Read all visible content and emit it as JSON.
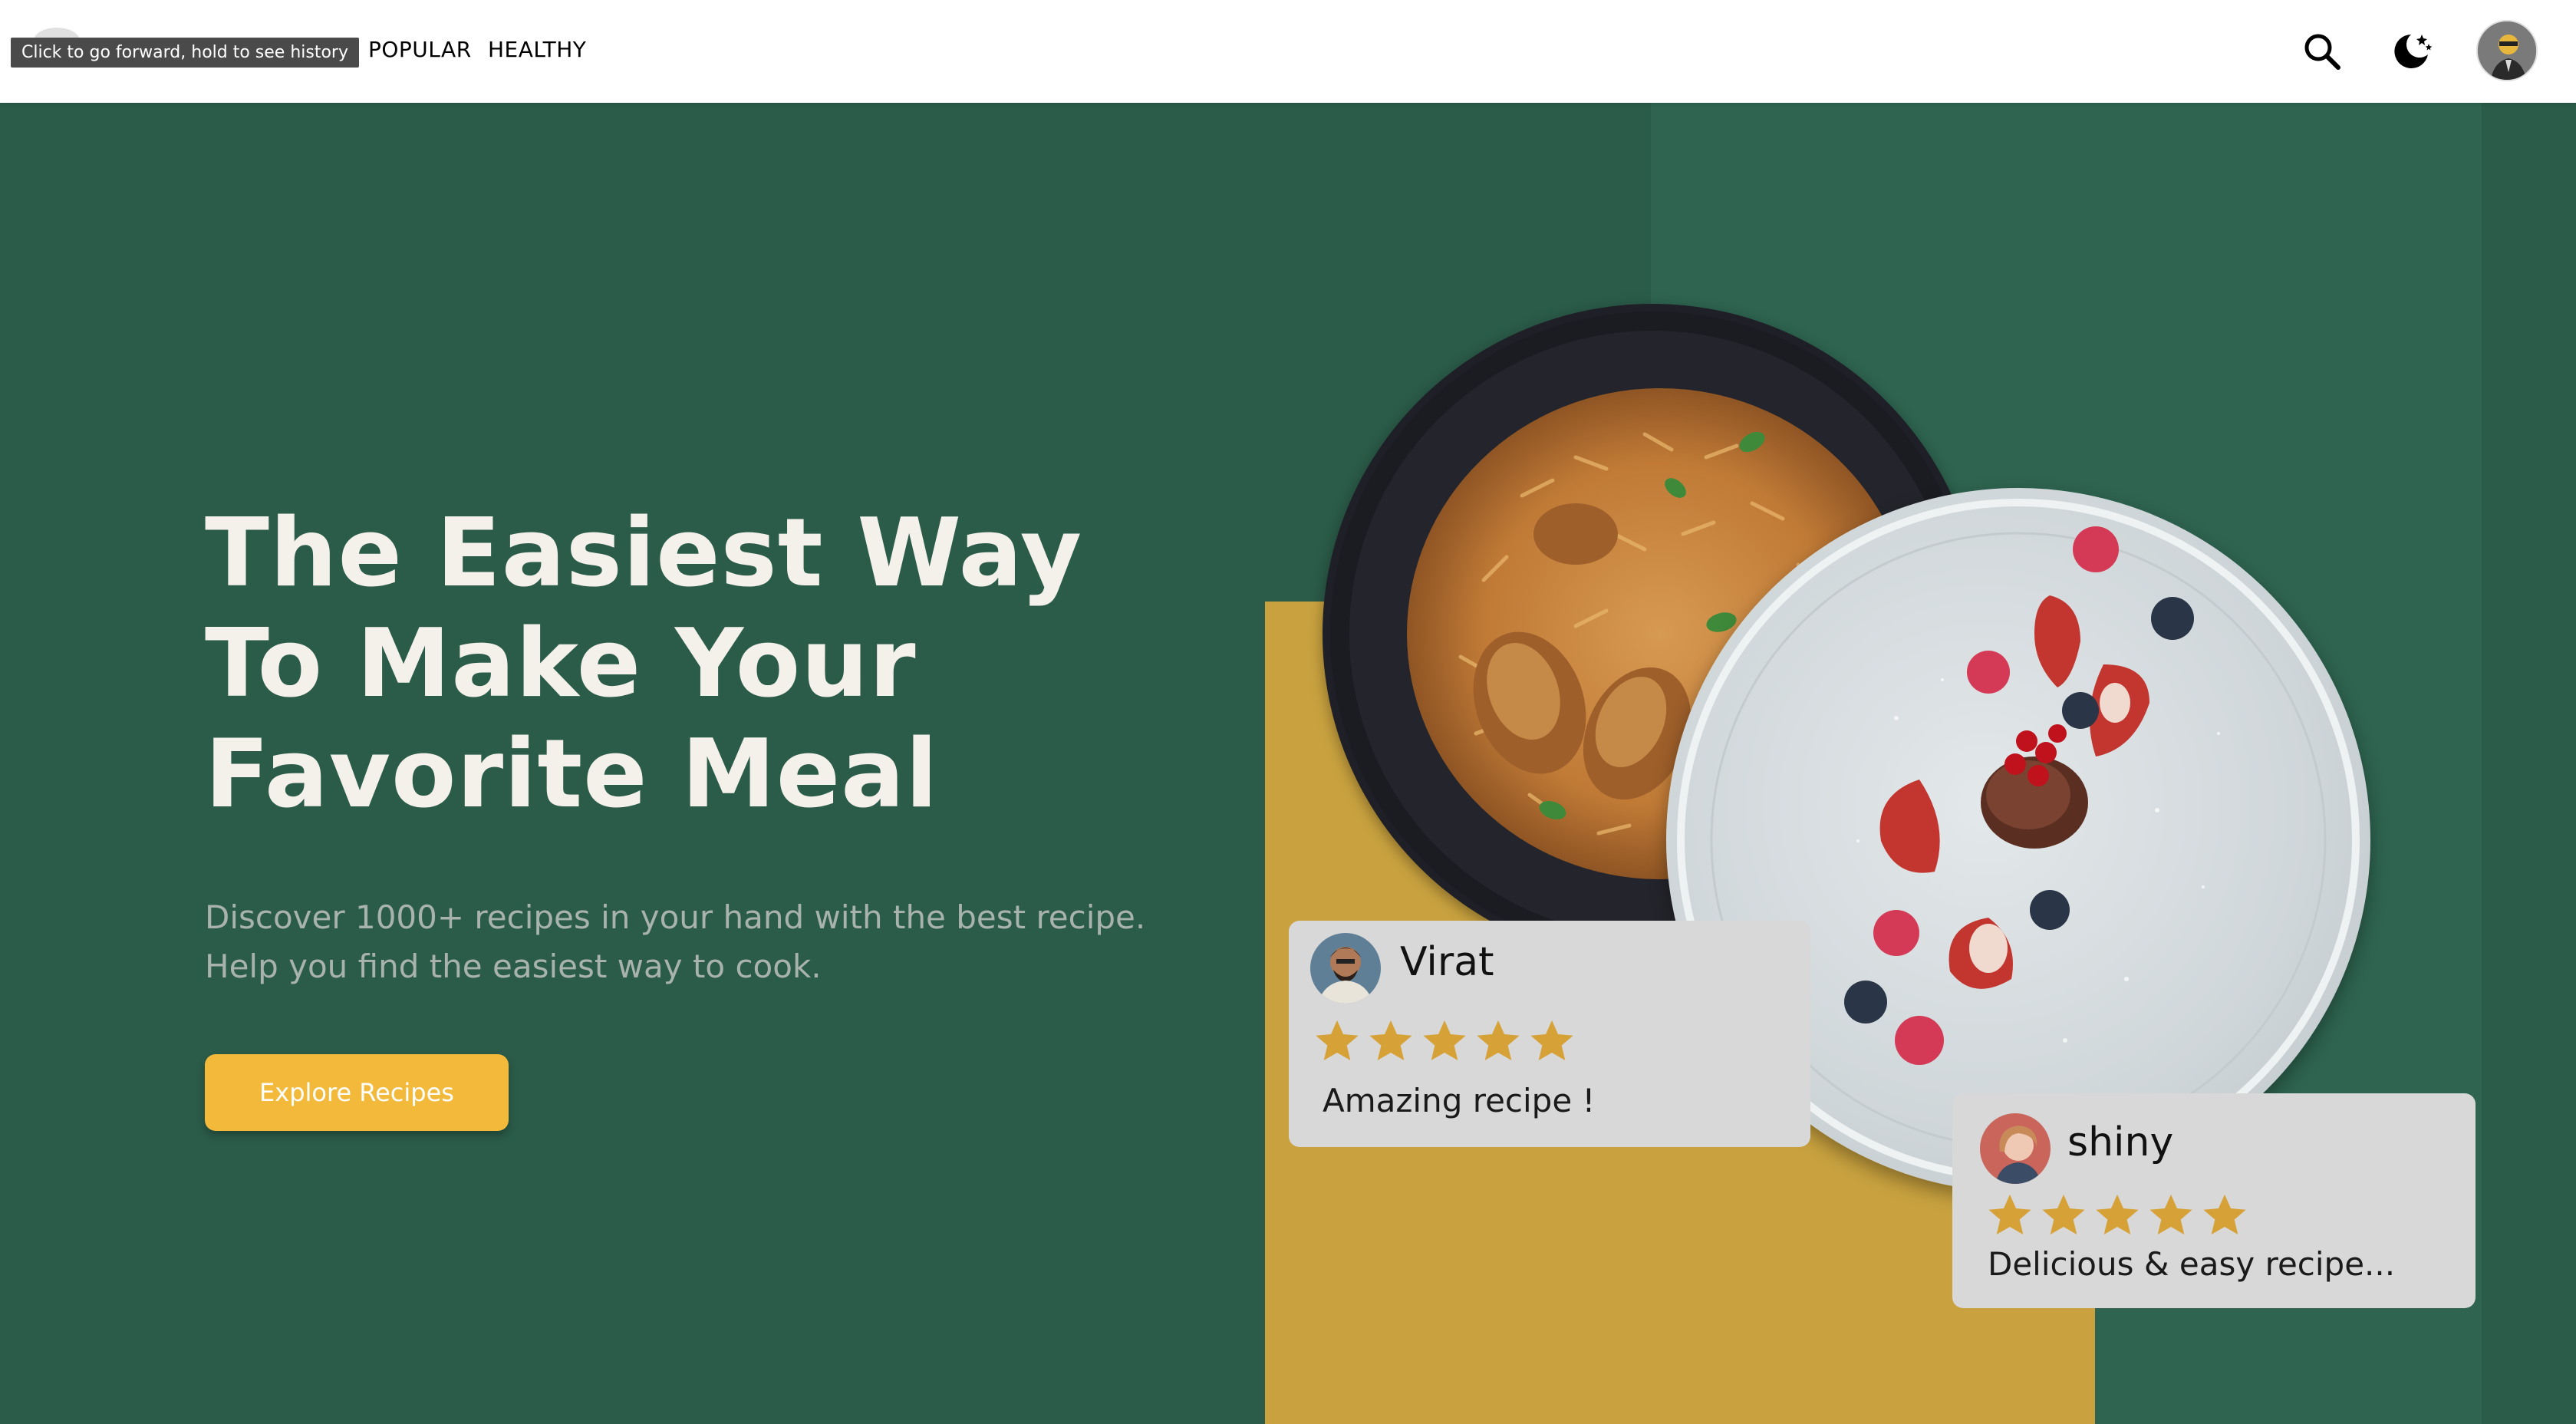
{
  "nav": {
    "items": [
      {
        "label": "POPULAR"
      },
      {
        "label": "HEALTHY"
      }
    ],
    "tooltip": "Click to go forward, hold to see history",
    "icons": [
      "search-icon",
      "theme-toggle-icon"
    ]
  },
  "hero": {
    "title_lines": [
      "The Easiest Way",
      "To Make Your",
      "Favorite Meal"
    ],
    "subtitle_lines": [
      "Discover 1000+ recipes in your hand with the best recipe.",
      "Help you find the easiest way to cook."
    ],
    "cta_label": "Explore Recipes"
  },
  "reviews": [
    {
      "name": "Virat",
      "rating": 5,
      "text": "Amazing recipe !"
    },
    {
      "name": "shiny",
      "rating": 5,
      "text": "Delicious & easy recipe..."
    }
  ],
  "colors": {
    "background": "#2b5b49",
    "panel": "#2e6450",
    "gold": "#c9a23f",
    "button": "#f2b93b",
    "star": "#d6a238",
    "review_card": "#d8d8d8"
  }
}
